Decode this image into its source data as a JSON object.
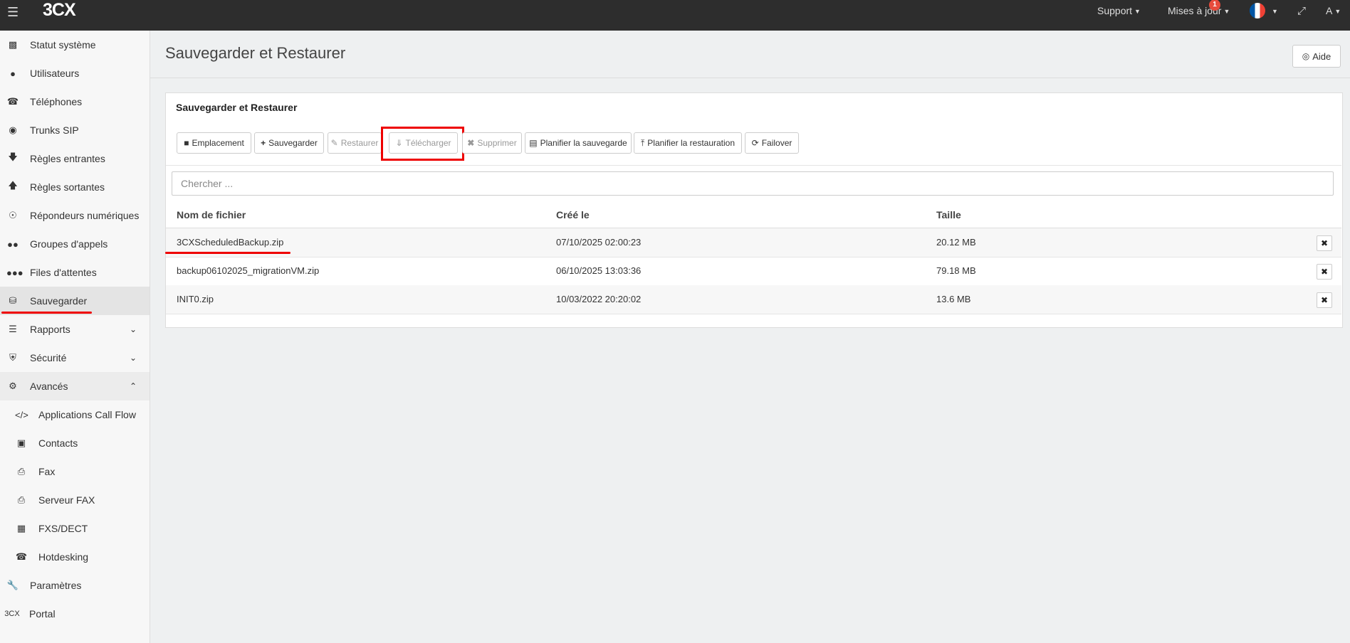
{
  "topbar": {
    "logo_text": "3CX",
    "support": "Support",
    "updates": "Mises à jour",
    "updates_badge": "1",
    "user": "A"
  },
  "sidebar": {
    "items": [
      {
        "label": "Statut système",
        "icon": "bar-chart-icon"
      },
      {
        "label": "Utilisateurs",
        "icon": "user-icon"
      },
      {
        "label": "Téléphones",
        "icon": "phone-icon"
      },
      {
        "label": "Trunks SIP",
        "icon": "globe-icon"
      },
      {
        "label": "Règles entrantes",
        "icon": "arrow-down-icon"
      },
      {
        "label": "Règles sortantes",
        "icon": "arrow-up-icon"
      },
      {
        "label": "Répondeurs numériques",
        "icon": "headset-icon"
      },
      {
        "label": "Groupes d'appels",
        "icon": "users-icon"
      },
      {
        "label": "Files d'attentes",
        "icon": "group-icon"
      },
      {
        "label": "Sauvegarder",
        "icon": "database-icon"
      },
      {
        "label": "Rapports",
        "icon": "list-icon"
      },
      {
        "label": "Sécurité",
        "icon": "shield-icon"
      },
      {
        "label": "Avancés",
        "icon": "gear-icon"
      },
      {
        "label": "Applications Call Flow",
        "icon": "code-icon"
      },
      {
        "label": "Contacts",
        "icon": "address-book-icon"
      },
      {
        "label": "Fax",
        "icon": "fax-icon"
      },
      {
        "label": "Serveur FAX",
        "icon": "fax-server-icon"
      },
      {
        "label": "FXS/DECT",
        "icon": "fxs-icon"
      },
      {
        "label": "Hotdesking",
        "icon": "hotdesk-icon"
      },
      {
        "label": "Paramètres",
        "icon": "wrench-icon"
      },
      {
        "label": "Portal",
        "icon": "3cx-icon",
        "icon_text": "3CX"
      }
    ]
  },
  "page": {
    "title": "Sauvegarder et Restaurer",
    "help_button": "Aide"
  },
  "panel": {
    "title": "Sauvegarder et Restaurer",
    "toolbar": {
      "location": "Emplacement",
      "backup": "Sauvegarder",
      "restore": "Restaurer",
      "download": "Télécharger",
      "delete": "Supprimer",
      "schedule_backup": "Planifier la sauvegarde",
      "schedule_restore": "Planifier la restauration",
      "failover": "Failover"
    },
    "search_placeholder": "Chercher ...",
    "columns": [
      "Nom de fichier",
      "Créé le",
      "Taille"
    ],
    "rows": [
      {
        "name": "3CXScheduledBackup.zip",
        "created": "07/10/2025 02:00:23",
        "size": "20.12 MB"
      },
      {
        "name": "backup06102025_migrationVM.zip",
        "created": "06/10/2025 13:03:36",
        "size": "79.18 MB"
      },
      {
        "name": "INIT0.zip",
        "created": "10/03/2022 20:20:02",
        "size": "13.6 MB"
      }
    ]
  },
  "colors": {
    "topbar": "#2d2d2d",
    "annotation_red": "#ee0000",
    "badge": "#e74c3c"
  }
}
